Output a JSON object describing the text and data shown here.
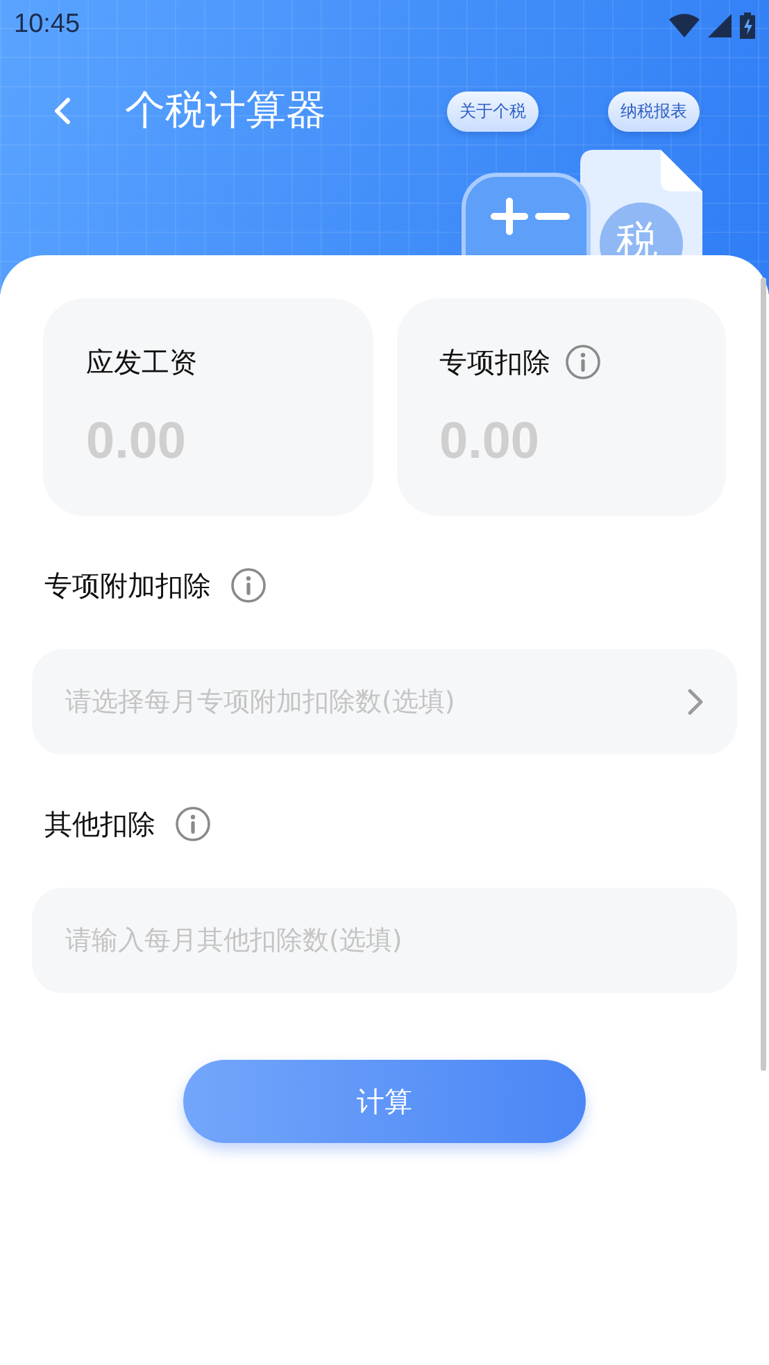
{
  "status_bar": {
    "time": "10:45"
  },
  "header": {
    "title": "个税计算器",
    "illustration_text": "税",
    "actions": [
      {
        "label": "关于个税"
      },
      {
        "label": "纳税报表"
      }
    ]
  },
  "summary_cards": [
    {
      "label": "应发工资",
      "info": false,
      "placeholder": "0.00"
    },
    {
      "label": "专项扣除",
      "info": true,
      "placeholder": "0.00"
    }
  ],
  "fields": [
    {
      "kind": "select",
      "label": "专项附加扣除",
      "info": true,
      "placeholder": "请选择每月专项附加扣除数(选填)"
    },
    {
      "kind": "input",
      "label": "其他扣除",
      "info": true,
      "placeholder": "请输入每月其他扣除数(选填)"
    }
  ],
  "calculate_button": {
    "label": "计算"
  }
}
